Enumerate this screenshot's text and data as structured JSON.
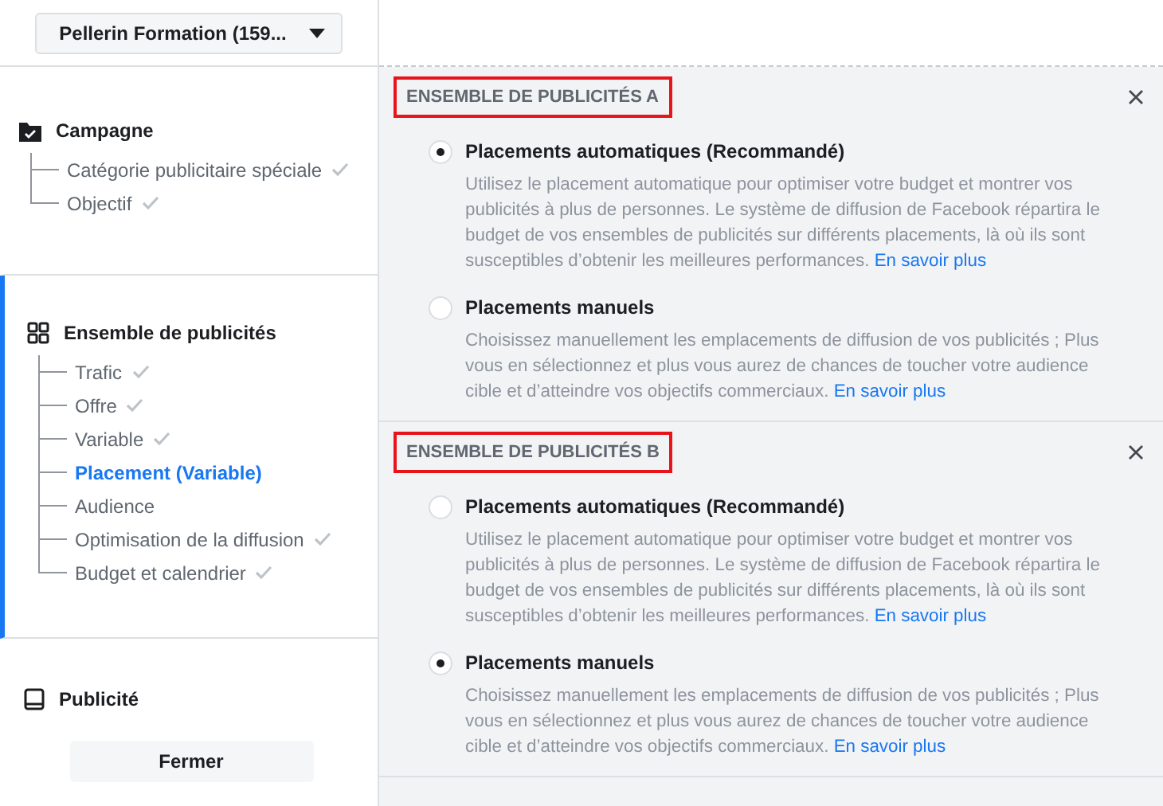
{
  "account_selector": {
    "label": "Pellerin Formation (159..."
  },
  "sidebar": {
    "sections": [
      {
        "kind": "campaign",
        "title": "Campagne",
        "active": false,
        "children": [
          {
            "label": "Catégorie publicitaire spéciale",
            "done": true,
            "selected": false
          },
          {
            "label": "Objectif",
            "done": true,
            "selected": false
          }
        ]
      },
      {
        "kind": "adset",
        "title": "Ensemble de publicités",
        "active": true,
        "children": [
          {
            "label": "Trafic",
            "done": true,
            "selected": false
          },
          {
            "label": "Offre",
            "done": true,
            "selected": false
          },
          {
            "label": "Variable",
            "done": true,
            "selected": false
          },
          {
            "label": "Placement (Variable)",
            "done": false,
            "selected": true
          },
          {
            "label": "Audience",
            "done": false,
            "selected": false
          },
          {
            "label": "Optimisation de la diffusion",
            "done": true,
            "selected": false
          },
          {
            "label": "Budget et calendrier",
            "done": true,
            "selected": false
          }
        ]
      },
      {
        "kind": "ad",
        "title": "Publicité",
        "active": false
      }
    ],
    "close_button": "Fermer"
  },
  "ad_sets": [
    {
      "title": "ENSEMBLE DE PUBLICITÉS A",
      "highlighted": true,
      "options": [
        {
          "label": "Placements automatiques (Recommandé)",
          "selected": true,
          "description": "Utilisez le placement automatique pour optimiser votre budget et montrer vos publicités à plus de personnes. Le système de diffusion de Facebook répartira le budget de vos ensembles de publicités sur différents placements, là où ils sont susceptibles d’obtenir les meilleures performances.",
          "link": "En savoir plus"
        },
        {
          "label": "Placements manuels",
          "selected": false,
          "description": "Choisissez manuellement les emplacements de diffusion de vos publicités ; Plus vous en sélectionnez et plus vous aurez de chances de toucher votre audience cible et d’atteindre vos objectifs commerciaux.",
          "link": "En savoir plus"
        }
      ]
    },
    {
      "title": "ENSEMBLE DE PUBLICITÉS B",
      "highlighted": true,
      "options": [
        {
          "label": "Placements automatiques (Recommandé)",
          "selected": false,
          "description": "Utilisez le placement automatique pour optimiser votre budget et montrer vos publicités à plus de personnes. Le système de diffusion de Facebook répartira le budget de vos ensembles de publicités sur différents placements, là où ils sont susceptibles d’obtenir les meilleures performances.",
          "link": "En savoir plus"
        },
        {
          "label": "Placements manuels",
          "selected": true,
          "description": "Choisissez manuellement les emplacements de diffusion de vos publicités ; Plus vous en sélectionnez et plus vous aurez de chances de toucher votre audience cible et d’atteindre vos objectifs commerciaux.",
          "link": "En savoir plus"
        }
      ]
    }
  ]
}
